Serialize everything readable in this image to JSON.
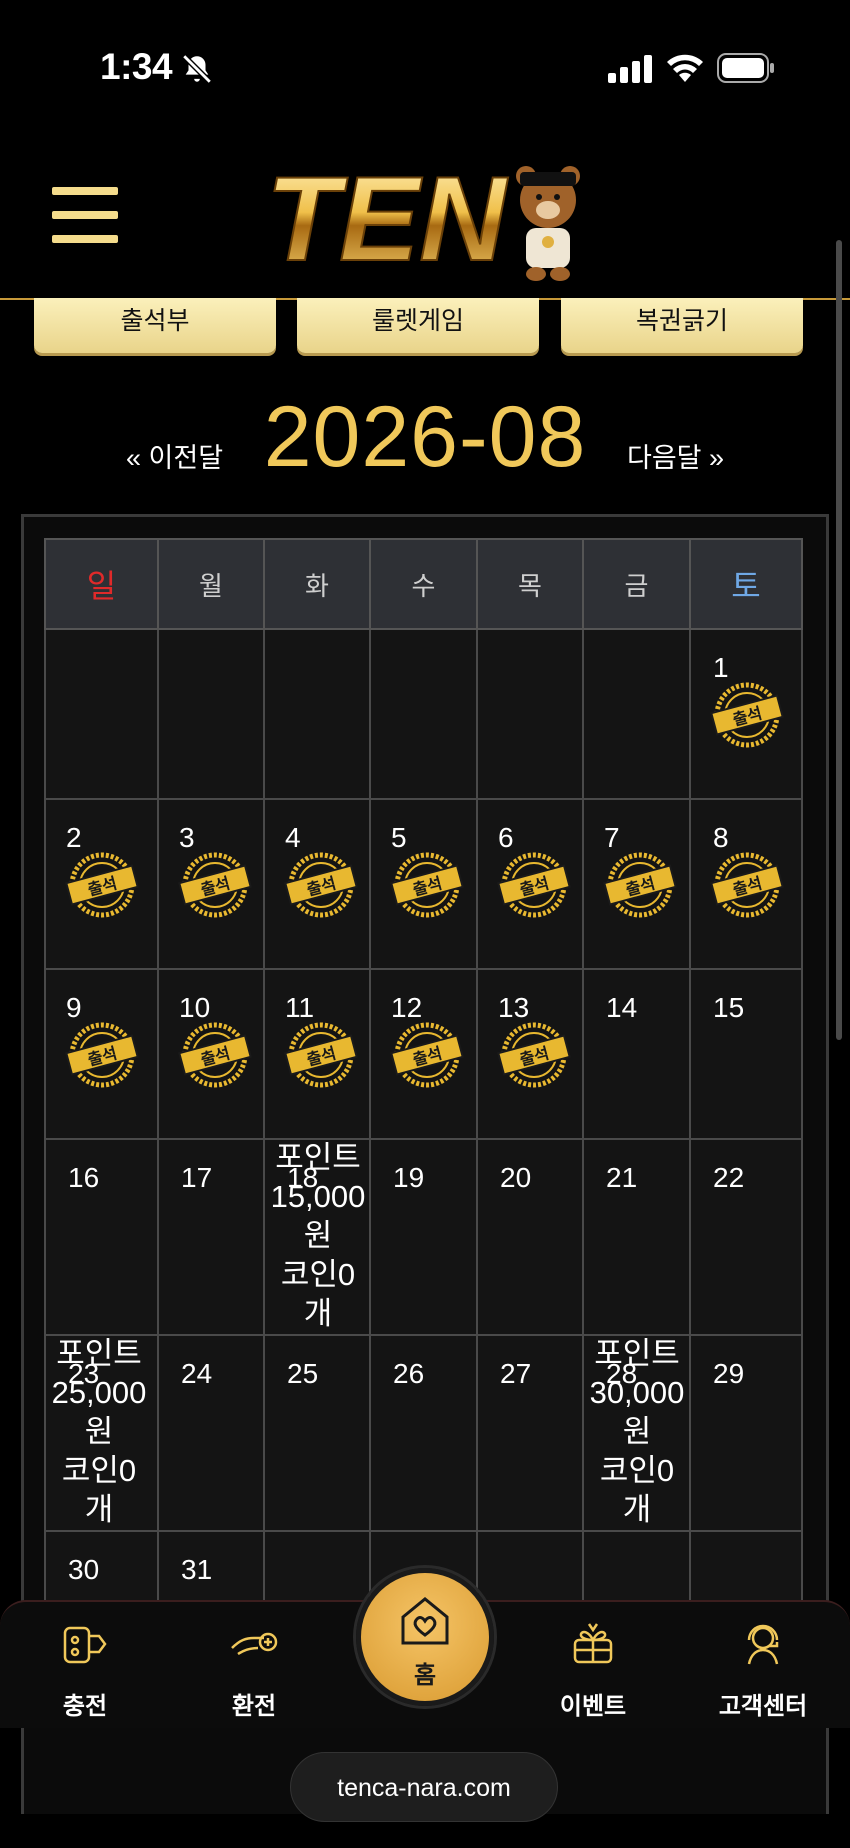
{
  "status": {
    "time": "1:34"
  },
  "header": {
    "logo_text": "TEN"
  },
  "tabs": [
    {
      "label": "출석부"
    },
    {
      "label": "룰렛게임"
    },
    {
      "label": "복권긁기"
    }
  ],
  "month_nav": {
    "prev_label": "« 이전달",
    "title": "2026-08",
    "next_label": "다음달 »"
  },
  "calendar": {
    "weekdays": [
      "일",
      "월",
      "화",
      "수",
      "목",
      "금",
      "토"
    ],
    "weekday_colors": {
      "sun": "#e02a2a",
      "sat": "#6fa8e6",
      "default": "#cfcfcf"
    },
    "stamp_text": "출석",
    "weeks": [
      [
        null,
        null,
        null,
        null,
        null,
        null,
        {
          "day": "1",
          "stamp": true
        }
      ],
      [
        {
          "day": "2",
          "stamp": true
        },
        {
          "day": "3",
          "stamp": true
        },
        {
          "day": "4",
          "stamp": true
        },
        {
          "day": "5",
          "stamp": true
        },
        {
          "day": "6",
          "stamp": true
        },
        {
          "day": "7",
          "stamp": true
        },
        {
          "day": "8",
          "stamp": true
        }
      ],
      [
        {
          "day": "9",
          "stamp": true
        },
        {
          "day": "10",
          "stamp": true
        },
        {
          "day": "11",
          "stamp": true
        },
        {
          "day": "12",
          "stamp": true
        },
        {
          "day": "13",
          "stamp": true
        },
        {
          "day": "14"
        },
        {
          "day": "15"
        }
      ],
      [
        {
          "day": "16"
        },
        {
          "day": "17"
        },
        {
          "day": "18",
          "note": [
            "포인트",
            "15,000",
            "원",
            "코인0",
            "개"
          ]
        },
        {
          "day": "19"
        },
        {
          "day": "20"
        },
        {
          "day": "21"
        },
        {
          "day": "22"
        }
      ],
      [
        {
          "day": "23",
          "note": [
            "포인트",
            "25,000",
            "원",
            "코인0",
            "개"
          ]
        },
        {
          "day": "24"
        },
        {
          "day": "25"
        },
        {
          "day": "26"
        },
        {
          "day": "27"
        },
        {
          "day": "28",
          "note": [
            "포인트",
            "30,000",
            "원",
            "코인0",
            "개"
          ]
        },
        {
          "day": "29"
        }
      ],
      [
        {
          "day": "30"
        },
        {
          "day": "31"
        },
        null,
        null,
        null,
        null,
        null
      ]
    ]
  },
  "bottom_nav": {
    "items": [
      {
        "label": "충전",
        "icon": "charge-icon"
      },
      {
        "label": "환전",
        "icon": "exchange-icon"
      },
      {
        "label": "홈",
        "icon": "home-heart-icon"
      },
      {
        "label": "이벤트",
        "icon": "gift-icon"
      },
      {
        "label": "고객센터",
        "icon": "support-icon"
      }
    ]
  },
  "browser": {
    "url": "tenca-nara.com"
  },
  "colors": {
    "accent_gold": "#f0c85a",
    "tab_bg": "#f4e2a0",
    "background": "#000000"
  }
}
